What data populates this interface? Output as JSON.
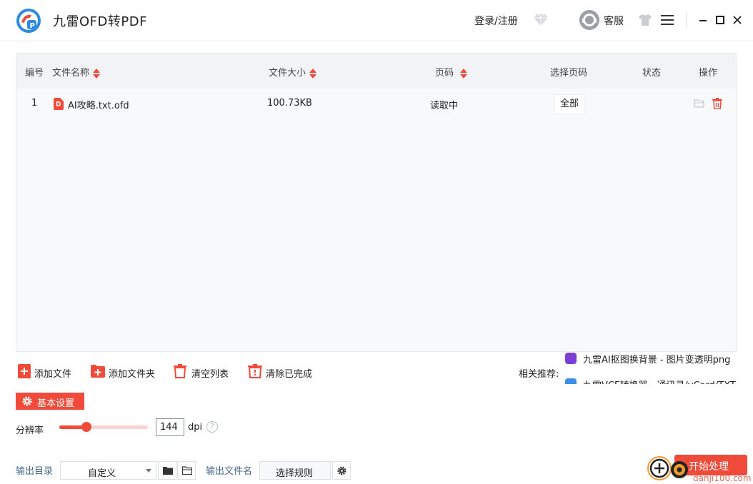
{
  "app": {
    "title": "九雷OFD转PDF"
  },
  "header": {
    "login_label": "登录/注册",
    "support_label": "客服",
    "icons": [
      "vip-diamond-icon",
      "avatar-icon",
      "theme-shirt-icon",
      "menu-icon",
      "minimize-icon",
      "maximize-icon",
      "close-icon"
    ]
  },
  "table": {
    "columns": {
      "index": "编号",
      "name": "文件名称",
      "size": "文件大小",
      "pages": "页码",
      "select_pages": "选择页码",
      "status": "状态",
      "actions": "操作"
    },
    "rows": [
      {
        "index": "1",
        "name": "AI攻略.txt.ofd",
        "size": "100.73KB",
        "pages": "读取中",
        "select_pages": "全部",
        "status": ""
      }
    ]
  },
  "toolbar": {
    "add_file": "添加文件",
    "add_folder": "添加文件夹",
    "clear_list": "清空列表",
    "clear_done": "清除已完成"
  },
  "recommend": {
    "label": "相关推荐:",
    "items": [
      {
        "text": "九雷AI抠图换背景 - 图片变透明png",
        "color": "#7b3fd6"
      },
      {
        "text": "九雷VCF转换器 - 通讯录/vCard/TXT",
        "color": "#3b8de6"
      }
    ]
  },
  "settings": {
    "basic_label": "基本设置",
    "resolution_label": "分辨率",
    "dpi_value": "144",
    "dpi_unit": "dpi",
    "help_glyph": "?",
    "slider_fraction": 0.31,
    "output_dir_label": "输出目录",
    "output_dir_value": "自定义",
    "output_name_label": "输出文件名",
    "rule_button": "选择规则"
  },
  "actions": {
    "start": "开始处理"
  },
  "watermark": {
    "text": "danji100.com"
  },
  "colors": {
    "accent": "#f04b3a",
    "link": "#4a6a8a"
  }
}
